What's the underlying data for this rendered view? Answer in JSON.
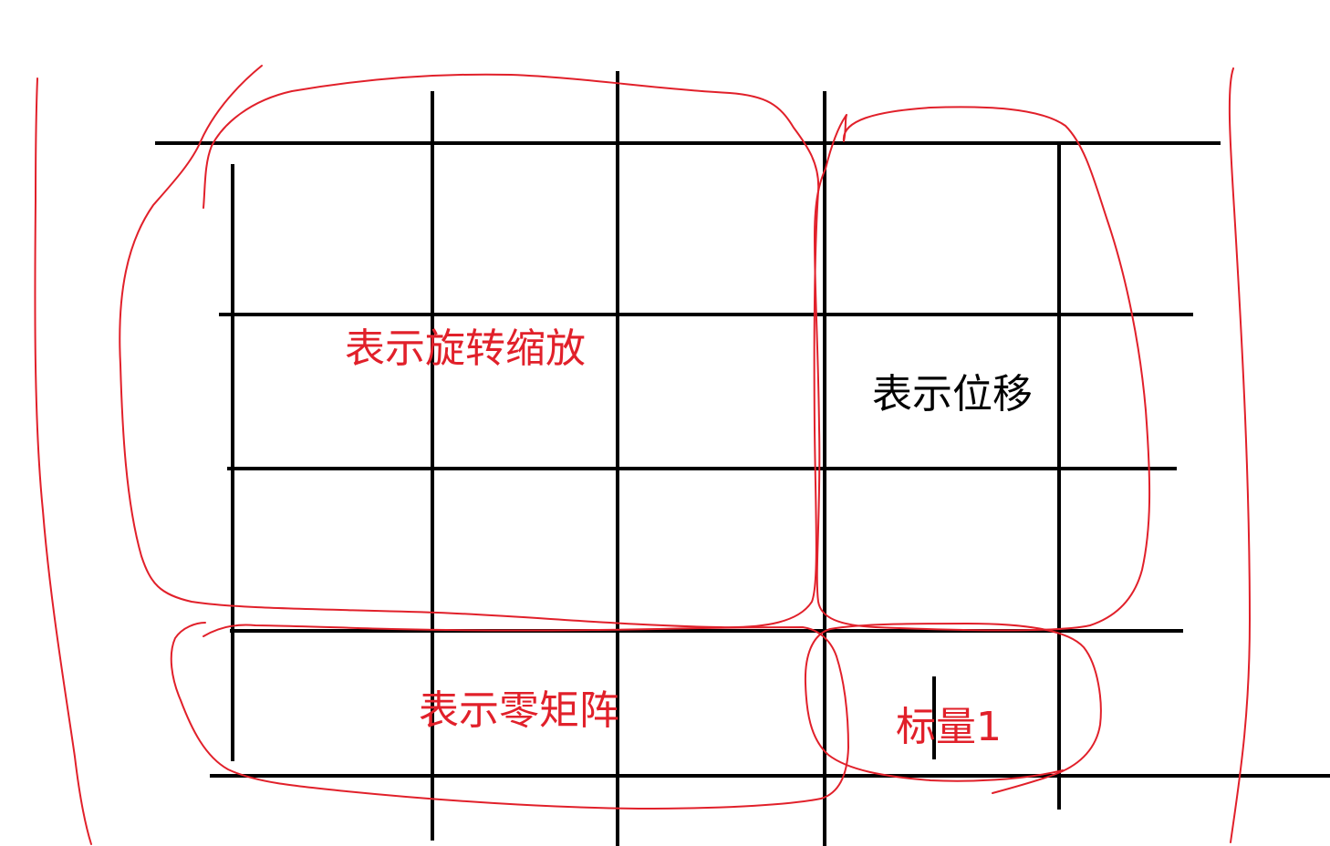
{
  "diagram": {
    "labels": {
      "rotation_scale": "表示旋转缩放",
      "translation": "表示位移",
      "zero_matrix": "表示零矩阵",
      "scalar_one": "标量1"
    },
    "colors": {
      "background": "#ffffff",
      "grid": "#000000",
      "annotation": "#e1202a",
      "translation_label": "#000000"
    }
  }
}
